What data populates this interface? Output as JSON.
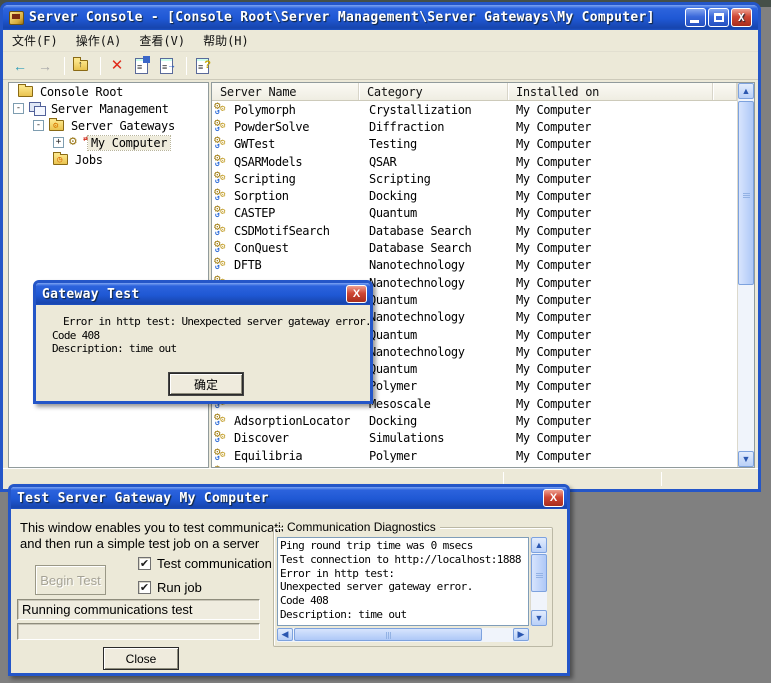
{
  "window": {
    "title": "Server Console - [Console Root\\Server Management\\Server Gateways\\My Computer]",
    "controls": {
      "minimize": "",
      "maximize": "",
      "close": "X"
    }
  },
  "menu": {
    "items": [
      {
        "label": "文件(F)"
      },
      {
        "label": "操作(A)"
      },
      {
        "label": "查看(V)"
      },
      {
        "label": "帮助(H)"
      }
    ]
  },
  "toolbar": {
    "icons": [
      "back",
      "forward",
      "up-one-level",
      "delete",
      "properties",
      "export-list",
      "help"
    ]
  },
  "tree": {
    "items": [
      {
        "label": "Console Root",
        "icon": "folder",
        "expander": "",
        "selected": false
      },
      {
        "label": "Server Management",
        "icon": "computers",
        "expander": "-",
        "selected": false
      },
      {
        "label": "Server Gateways",
        "icon": "folder-gear",
        "expander": "-",
        "selected": false
      },
      {
        "label": "My Computer",
        "icon": "gateway-gear",
        "expander": "+",
        "selected": true
      },
      {
        "label": "Jobs",
        "icon": "folder-check",
        "expander": "",
        "selected": false
      }
    ]
  },
  "list": {
    "columns": [
      "Server Name",
      "Category",
      "Installed on"
    ],
    "rows": [
      {
        "name": "Polymorph",
        "category": "Crystallization",
        "installed": "My Computer"
      },
      {
        "name": "PowderSolve",
        "category": "Diffraction",
        "installed": "My Computer"
      },
      {
        "name": "GWTest",
        "category": "Testing",
        "installed": "My Computer"
      },
      {
        "name": "QSARModels",
        "category": "QSAR",
        "installed": "My Computer"
      },
      {
        "name": "Scripting",
        "category": "Scripting",
        "installed": "My Computer"
      },
      {
        "name": "Sorption",
        "category": "Docking",
        "installed": "My Computer"
      },
      {
        "name": "CASTEP",
        "category": "Quantum",
        "installed": "My Computer"
      },
      {
        "name": "CSDMotifSearch",
        "category": "Database Search",
        "installed": "My Computer"
      },
      {
        "name": "ConQuest",
        "category": "Database Search",
        "installed": "My Computer"
      },
      {
        "name": "DFTB",
        "category": "Nanotechnology",
        "installed": "My Computer"
      },
      {
        "name": "",
        "category": "Nanotechnology",
        "installed": "My Computer"
      },
      {
        "name": "",
        "category": "Quantum",
        "installed": "My Computer"
      },
      {
        "name": "",
        "category": "Nanotechnology",
        "installed": "My Computer"
      },
      {
        "name": "",
        "category": "Quantum",
        "installed": "My Computer"
      },
      {
        "name": "",
        "category": "Nanotechnology",
        "installed": "My Computer"
      },
      {
        "name": "",
        "category": "Quantum",
        "installed": "My Computer"
      },
      {
        "name": "",
        "category": "Polymer",
        "installed": "My Computer"
      },
      {
        "name": "",
        "category": "Mesoscale",
        "installed": "My Computer"
      },
      {
        "name": "AdsorptionLocator",
        "category": "Docking",
        "installed": "My Computer"
      },
      {
        "name": "Discover",
        "category": "Simulations",
        "installed": "My Computer"
      },
      {
        "name": "Equilibria",
        "category": "Polymer",
        "installed": "My Computer"
      },
      {
        "name": "",
        "category": "",
        "installed": ""
      }
    ]
  },
  "gateway_dialog": {
    "title": "Gateway Test",
    "line1": "Error in http test: Unexpected server gateway error.",
    "line2": "Code 408",
    "line3": "Description: time out",
    "ok_label": "确定",
    "close_label": "X"
  },
  "test_dialog": {
    "title": "Test Server Gateway My Computer",
    "close_label": "X",
    "intro_line1": "This window enables you to test communications",
    "intro_line2": "and then run a simple test job on a server",
    "begin_button": "Begin Test",
    "checkbox_test_communication": {
      "label": "Test communication",
      "checked": "✔"
    },
    "checkbox_run_job": {
      "label": "Run job",
      "checked": "✔"
    },
    "status_field": "Running communications test",
    "close_button": "Close",
    "group_title": "Communication Diagnostics",
    "diagnostics": [
      "Ping round trip time was 0 msecs",
      "Test connection to http://localhost:1888",
      "Error in http test:",
      "Unexpected server gateway error.",
      "Code 408",
      "Description: time out"
    ]
  },
  "colors": {
    "titlebar_blue": "#1f58d4",
    "window_border": "#2456c8",
    "dialog_face": "#ece9d8",
    "desktop_gray": "#808080",
    "desktop_dark": "#4d574f",
    "close_button_red": "#cf4734",
    "list_bg": "#ffffff"
  }
}
